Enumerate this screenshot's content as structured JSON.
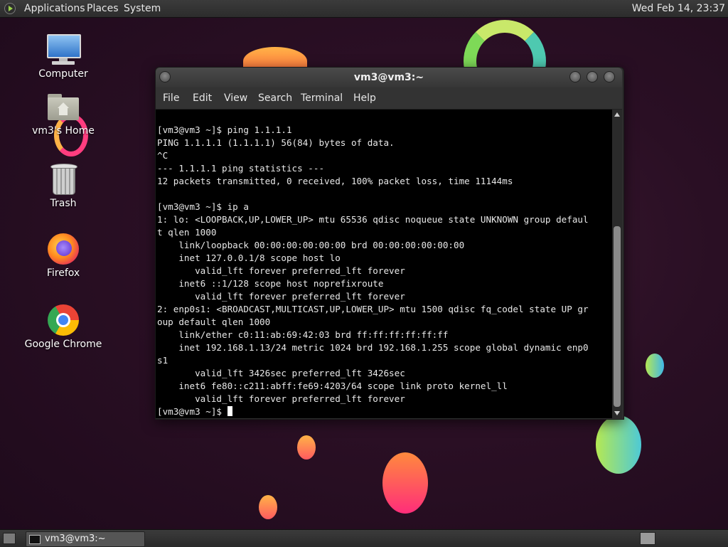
{
  "top_panel": {
    "menus": [
      "Applications",
      "Places",
      "System"
    ],
    "clock": "Wed Feb 14, 23:37"
  },
  "desktop_icons": [
    {
      "label": "Computer",
      "icon": "computer-icon"
    },
    {
      "label": "vm3's Home",
      "icon": "home-folder-icon"
    },
    {
      "label": "Trash",
      "icon": "trash-icon"
    },
    {
      "label": "Firefox",
      "icon": "firefox-icon"
    },
    {
      "label": "Google Chrome",
      "icon": "chrome-icon"
    }
  ],
  "window": {
    "title": "vm3@vm3:~",
    "menu": [
      "File",
      "Edit",
      "View",
      "Search",
      "Terminal",
      "Help"
    ],
    "terminal_lines": [
      "[vm3@vm3 ~]$ ping 1.1.1.1",
      "PING 1.1.1.1 (1.1.1.1) 56(84) bytes of data.",
      "^C",
      "--- 1.1.1.1 ping statistics ---",
      "12 packets transmitted, 0 received, 100% packet loss, time 11144ms",
      "",
      "[vm3@vm3 ~]$ ip a",
      "1: lo: <LOOPBACK,UP,LOWER_UP> mtu 65536 qdisc noqueue state UNKNOWN group defaul",
      "t qlen 1000",
      "    link/loopback 00:00:00:00:00:00 brd 00:00:00:00:00:00",
      "    inet 127.0.0.1/8 scope host lo",
      "       valid_lft forever preferred_lft forever",
      "    inet6 ::1/128 scope host noprefixroute",
      "       valid_lft forever preferred_lft forever",
      "2: enp0s1: <BROADCAST,MULTICAST,UP,LOWER_UP> mtu 1500 qdisc fq_codel state UP gr",
      "oup default qlen 1000",
      "    link/ether c0:11:ab:69:42:03 brd ff:ff:ff:ff:ff:ff",
      "    inet 192.168.1.13/24 metric 1024 brd 192.168.1.255 scope global dynamic enp0",
      "s1",
      "       valid_lft 3426sec preferred_lft 3426sec",
      "    inet6 fe80::c211:abff:fe69:4203/64 scope link proto kernel_ll",
      "       valid_lft forever preferred_lft forever"
    ],
    "prompt": "[vm3@vm3 ~]$ "
  },
  "bottom_panel": {
    "task_label": "vm3@vm3:~"
  }
}
